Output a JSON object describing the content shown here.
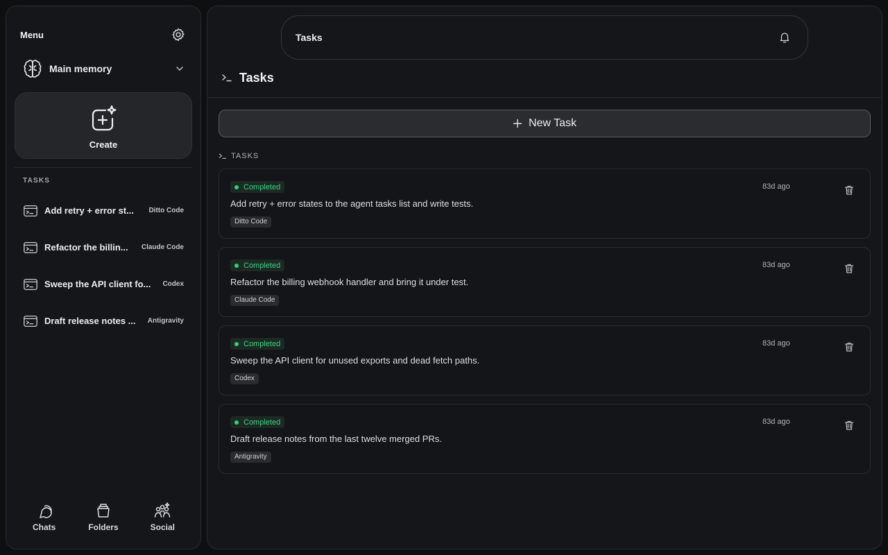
{
  "sidebar": {
    "title": "Menu",
    "memory_label": "Main memory",
    "create_label": "Create",
    "section_label": "TASKS",
    "tasks": [
      {
        "title": "Add retry + error st...",
        "agent": "Ditto Code"
      },
      {
        "title": "Refactor the billin...",
        "agent": "Claude Code"
      },
      {
        "title": "Sweep the API client fo...",
        "agent": "Codex"
      },
      {
        "title": "Draft release notes ...",
        "agent": "Antigravity"
      }
    ],
    "nav": [
      {
        "label": "Chats",
        "icon": "chat-bubble-icon"
      },
      {
        "label": "Folders",
        "icon": "folder-icon"
      },
      {
        "label": "Social",
        "icon": "people-icon"
      }
    ]
  },
  "topbar": {
    "title": "Tasks"
  },
  "page": {
    "title": "Tasks",
    "new_task_label": "New Task",
    "list_label": "TASKS"
  },
  "tasks": [
    {
      "status": "Completed",
      "time": "83d ago",
      "description": "Add retry + error states to the agent tasks list and write tests.",
      "agent": "Ditto Code"
    },
    {
      "status": "Completed",
      "time": "83d ago",
      "description": "Refactor the billing webhook handler and bring it under test.",
      "agent": "Claude Code"
    },
    {
      "status": "Completed",
      "time": "83d ago",
      "description": "Sweep the API client for unused exports and dead fetch paths.",
      "agent": "Codex"
    },
    {
      "status": "Completed",
      "time": "83d ago",
      "description": "Draft release notes from the last twelve merged PRs.",
      "agent": "Antigravity"
    }
  ],
  "colors": {
    "background": "#0e0f11",
    "panel": "#151619",
    "status_green": "#35d07f"
  }
}
